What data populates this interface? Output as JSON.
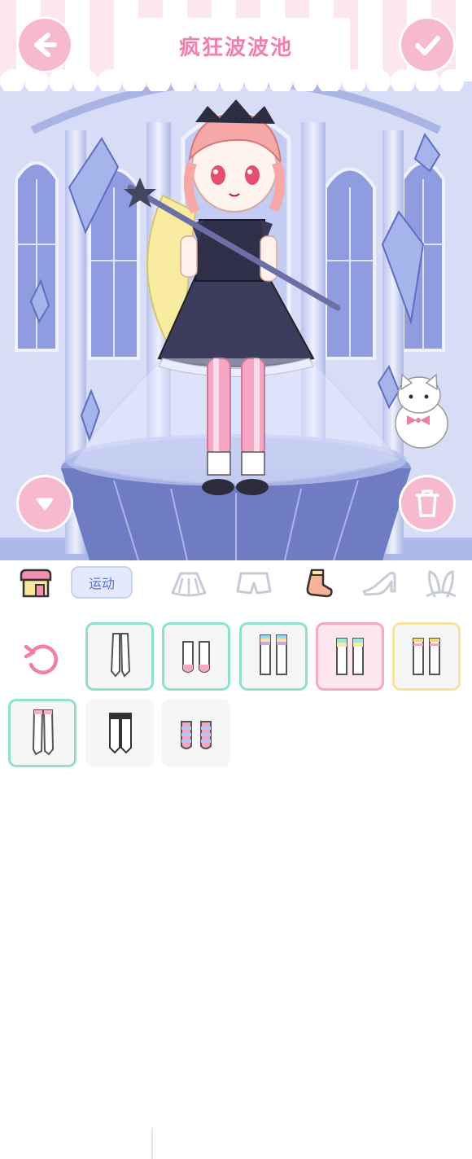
{
  "header": {
    "title": "疯狂波波池"
  },
  "buttons": {
    "back_icon": "arrow-left-icon",
    "confirm_icon": "check-icon",
    "collapse_icon": "chevron-down-icon",
    "delete_icon": "trash-icon"
  },
  "toolbar": {
    "category_label": "运动",
    "tools": [
      {
        "icon": "shop-icon"
      },
      {
        "icon": "skirt-icon"
      },
      {
        "icon": "shorts-icon"
      },
      {
        "icon": "sock-icon",
        "selected": true
      },
      {
        "icon": "high-heel-icon"
      },
      {
        "icon": "bunny-ears-icon"
      }
    ]
  },
  "grid": {
    "reset_icon": "reset-icon",
    "items": [
      {
        "icon": "stockings-white-icon",
        "border": "#8ee0cf"
      },
      {
        "icon": "socks-pink-toe-icon",
        "border": "#8ee0cf"
      },
      {
        "icon": "socks-rainbow-top-icon",
        "border": "#8ee0cf"
      },
      {
        "icon": "socks-pastel-stripe-icon",
        "border": "#f6a9c6",
        "selected": true
      },
      {
        "icon": "socks-yellow-top-icon",
        "border": "#f7e3a0"
      },
      {
        "icon": "stockings-pink-band-icon",
        "border": "#8ee0cf"
      },
      {
        "icon": "stockings-black-band-icon",
        "border": null
      },
      {
        "icon": "socks-pink-blue-stripe-icon",
        "border": null
      }
    ]
  },
  "colors": {
    "accent": "#f07fae",
    "button_pink": "#f7b9d0",
    "mint": "#8ee0cf"
  }
}
